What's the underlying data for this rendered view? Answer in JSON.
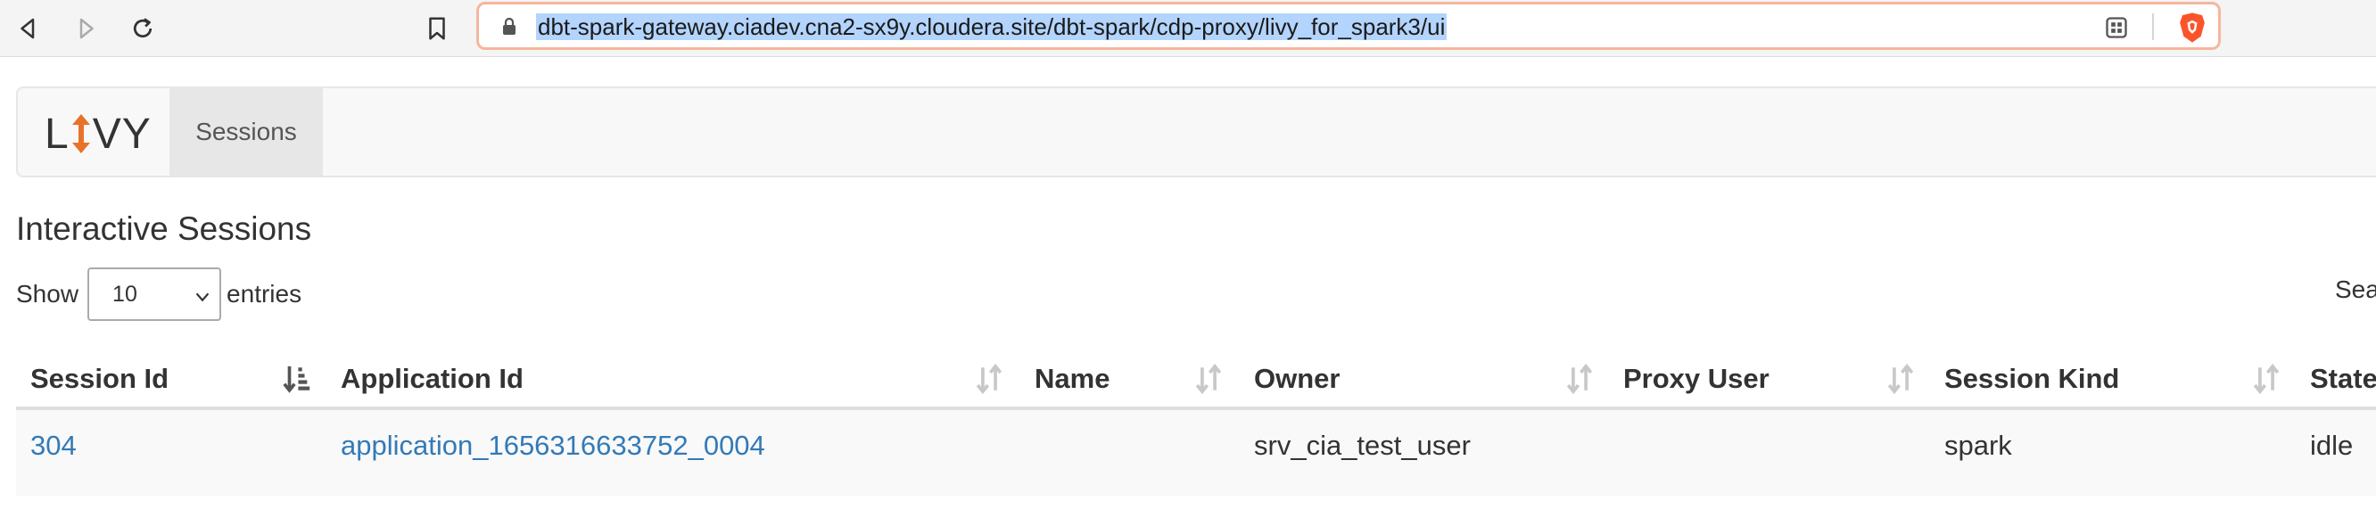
{
  "browser": {
    "url": "dbt-spark-gateway.ciadev.cna2-sx9y.cloudera.site/dbt-spark/cdp-proxy/livy_for_spark3/ui",
    "accent_color": "#f6b69b"
  },
  "navbar": {
    "brand_left": "L",
    "brand_right": "VY",
    "brand_arrow_color": "#e8722a",
    "sessions_label": "Sessions"
  },
  "page": {
    "heading": "Interactive Sessions",
    "show_label": "Show",
    "length_value": "10",
    "entries_label": "entries",
    "search_label": "Sea"
  },
  "table": {
    "columns": [
      "Session Id",
      "Application Id",
      "Name",
      "Owner",
      "Proxy User",
      "Session Kind",
      "State"
    ],
    "rows": [
      {
        "session_id": "304",
        "application_id": "application_1656316633752_0004",
        "name": "",
        "owner": "srv_cia_test_user",
        "proxy_user": "",
        "session_kind": "spark",
        "state": "idle"
      }
    ]
  },
  "colors": {
    "link": "#337ab7",
    "row_stripe": "#f9f9f9"
  }
}
